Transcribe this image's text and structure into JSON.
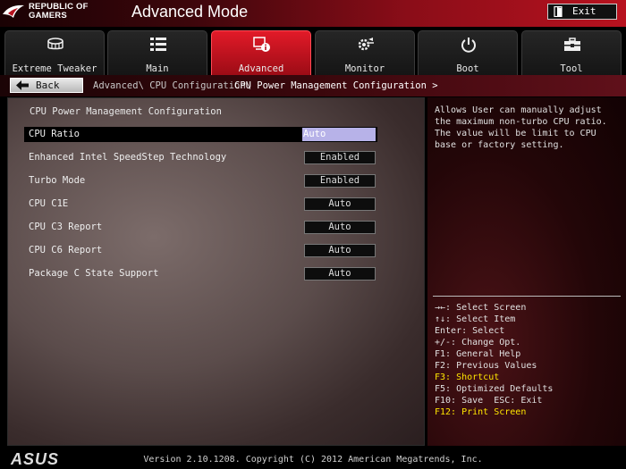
{
  "header": {
    "brand_line1": "REPUBLIC OF",
    "brand_line2": "GAMERS",
    "mode_title": "Advanced Mode",
    "exit_label": "Exit"
  },
  "tabs": [
    {
      "label": "Extreme Tweaker",
      "icon": "fan-icon",
      "active": false
    },
    {
      "label": "Main",
      "icon": "list-icon",
      "active": false
    },
    {
      "label": "Advanced",
      "icon": "advanced-info-icon",
      "active": true
    },
    {
      "label": "Monitor",
      "icon": "monitor-gear-icon",
      "active": false
    },
    {
      "label": "Boot",
      "icon": "power-icon",
      "active": false
    },
    {
      "label": "Tool",
      "icon": "toolbox-icon",
      "active": false
    }
  ],
  "breadcrumb": {
    "back_label": "Back",
    "path": "Advanced\\ CPU Configuration\\",
    "current": "CPU Power Management Configuration >"
  },
  "main": {
    "section_title": "CPU Power Management Configuration",
    "rows": [
      {
        "label": "CPU Ratio",
        "value": "Auto",
        "selected": true
      },
      {
        "label": "Enhanced Intel SpeedStep Technology",
        "value": "Enabled",
        "selected": false
      },
      {
        "label": "Turbo Mode",
        "value": "Enabled",
        "selected": false
      },
      {
        "label": "CPU C1E",
        "value": "Auto",
        "selected": false
      },
      {
        "label": "CPU C3 Report",
        "value": "Auto",
        "selected": false
      },
      {
        "label": "CPU C6 Report",
        "value": "Auto",
        "selected": false
      },
      {
        "label": "Package C State Support",
        "value": "Auto",
        "selected": false
      }
    ]
  },
  "help": {
    "text": "Allows User can manually adjust the maximum non-turbo CPU ratio. The value will be limit to CPU base or factory setting.",
    "keys": [
      {
        "text": "→←: Select Screen",
        "highlight": false
      },
      {
        "text": "↑↓: Select Item",
        "highlight": false
      },
      {
        "text": "Enter: Select",
        "highlight": false
      },
      {
        "text": "+/-: Change Opt.",
        "highlight": false
      },
      {
        "text": "F1: General Help",
        "highlight": false
      },
      {
        "text": "F2: Previous Values",
        "highlight": false
      },
      {
        "text": "F3: Shortcut",
        "highlight": true
      },
      {
        "text": "F5: Optimized Defaults",
        "highlight": false
      },
      {
        "text": "F10: Save  ESC: Exit",
        "highlight": false
      },
      {
        "text": "F12: Print Screen",
        "highlight": true
      }
    ]
  },
  "footer": {
    "logo": "ASUS",
    "version": "Version 2.10.1208. Copyright (C) 2012 American Megatrends, Inc."
  },
  "colors": {
    "accent_red": "#e21a28",
    "highlight_key": "#ffe600",
    "selected_value": "#b7b2e8"
  }
}
